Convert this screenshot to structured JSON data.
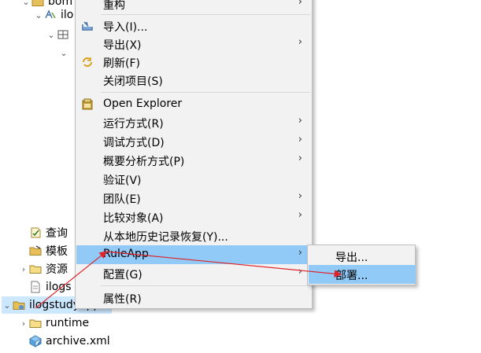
{
  "tree": {
    "nodes": [
      {
        "label": "bom",
        "icon": "folder-icon"
      },
      {
        "label": "ilo",
        "icon": "bom-model-icon"
      },
      {
        "label": "",
        "icon": "package-icon"
      },
      {
        "label": "",
        "icon": ""
      },
      {
        "label": "查询",
        "icon": "query-icon"
      },
      {
        "label": "模板",
        "icon": "template-icon"
      },
      {
        "label": "资源",
        "icon": "folder-icon"
      },
      {
        "label": "ilogs",
        "icon": "file-icon"
      },
      {
        "label": "ilogstudyapp",
        "icon": "project-icon"
      },
      {
        "label": "runtime",
        "icon": "folder-icon"
      },
      {
        "label": "archive.xml",
        "icon": "xml-file-icon"
      }
    ]
  },
  "menu": {
    "items": [
      {
        "label": "重构",
        "has_submenu": true
      },
      {
        "label": "导入(I)...",
        "icon": "import-icon"
      },
      {
        "label": "导出(X)",
        "has_submenu": true
      },
      {
        "label": "刷新(F)",
        "icon": "refresh-icon"
      },
      {
        "label": "关闭项目(S)"
      },
      {
        "label": "Open Explorer",
        "icon": "explorer-icon"
      },
      {
        "label": "运行方式(R)",
        "has_submenu": true
      },
      {
        "label": "调试方式(D)",
        "has_submenu": true
      },
      {
        "label": "概要分析方式(P)",
        "has_submenu": true
      },
      {
        "label": "验证(V)"
      },
      {
        "label": "团队(E)",
        "has_submenu": true
      },
      {
        "label": "比较对象(A)",
        "has_submenu": true
      },
      {
        "label": "从本地历史记录恢复(Y)..."
      },
      {
        "label": "RuleApp",
        "has_submenu": true,
        "highlighted": true
      },
      {
        "label": "配置(G)",
        "has_submenu": true
      },
      {
        "label": "属性(R)"
      }
    ],
    "submenu_arrow": "›"
  },
  "submenu": {
    "items": [
      {
        "label": "导出..."
      },
      {
        "label": "部署...",
        "highlighted": true
      }
    ]
  },
  "colors": {
    "menu_bg": "#f2f2f2",
    "highlight": "#91c9f7",
    "selection": "#cce8ff",
    "annotation": "#e0242b"
  }
}
